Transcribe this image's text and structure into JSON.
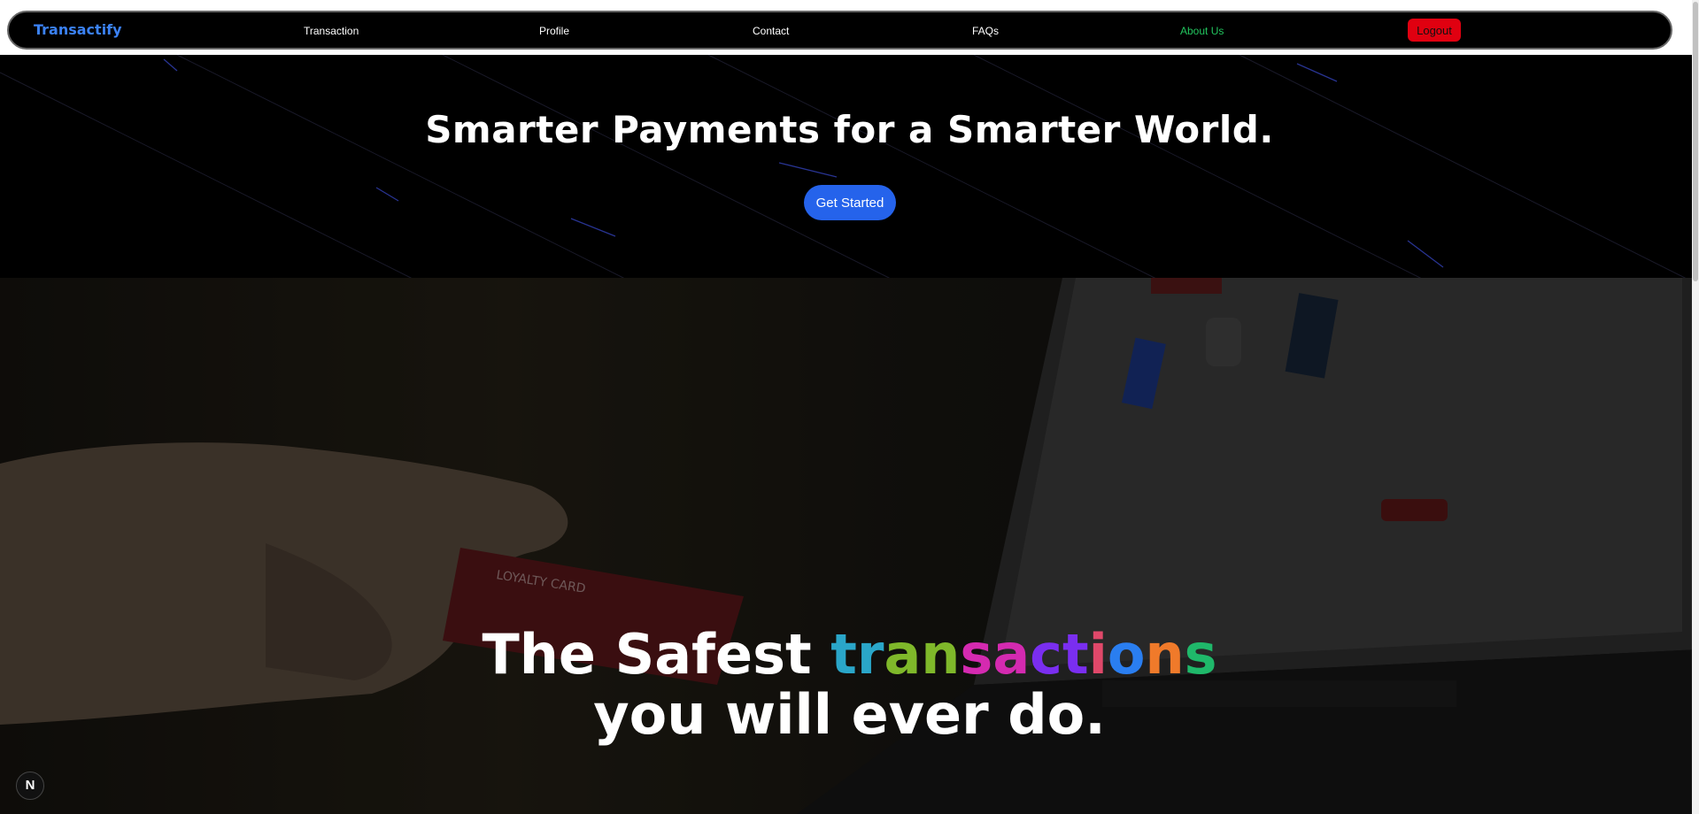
{
  "nav": {
    "brand": "Transactify",
    "links": [
      "Transaction",
      "Profile",
      "Contact",
      "FAQs",
      "About Us"
    ],
    "active": "About Us",
    "logout_label": "Logout"
  },
  "hero": {
    "title": "Smarter Payments for a Smarter World.",
    "cta_label": "Get Started"
  },
  "headline": {
    "prefix": "The Safest ",
    "rainbow_word": "transactions",
    "rainbow_colors": [
      "#2aa6c9",
      "#2aa6c9",
      "#7fb82a",
      "#7fb82a",
      "#d42ab0",
      "#d42ab0",
      "#7a2ef0",
      "#7a2ef0",
      "#e0486a",
      "#2a7ef0",
      "#f07a2a",
      "#1fb86a"
    ],
    "line2": "you will ever do."
  },
  "badge": "N",
  "colors": {
    "brand": "#3b82f6",
    "active_link": "#22c55e",
    "logout": "#e00010",
    "cta": "#2563eb"
  }
}
